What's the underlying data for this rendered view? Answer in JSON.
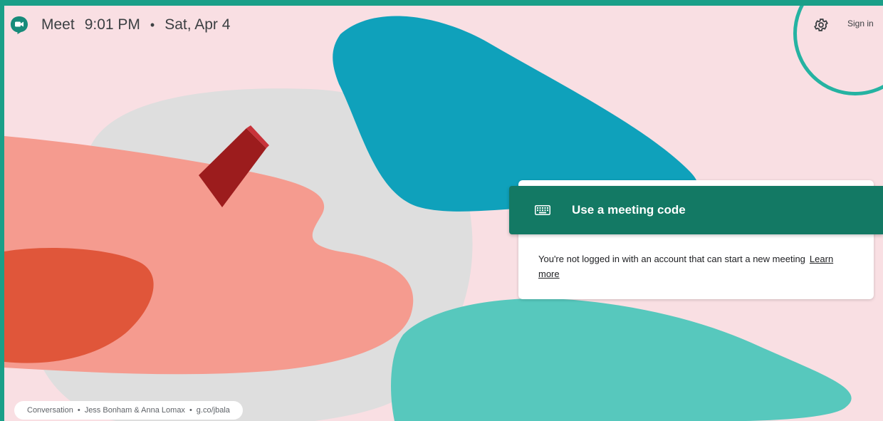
{
  "header": {
    "app_name": "Meet",
    "time": "9:01 PM",
    "separator": "•",
    "date": "Sat, Apr 4",
    "signin_label": "Sign in",
    "settings_icon": "gear-icon"
  },
  "card": {
    "button_label": "Use a meeting code",
    "button_icon": "keyboard-icon",
    "message": "You're not logged in with an account that can start a new meeting",
    "learn_more": "Learn more"
  },
  "footer": {
    "credit_title": "Conversation",
    "credit_artists": "Jess Bonham & Anna Lomax",
    "credit_link": "g.co/jbala",
    "dot": "•"
  },
  "colors": {
    "frame": "#1a9f88",
    "background": "#f9dfe3",
    "accent_button": "#137964",
    "highlight_ring": "#25b3a2"
  }
}
